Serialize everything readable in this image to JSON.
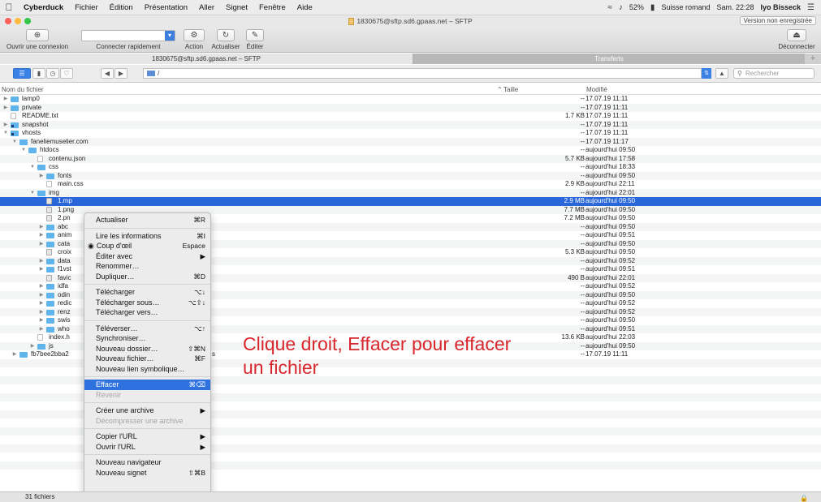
{
  "menubar": {
    "app": "Cyberduck",
    "items": [
      "Fichier",
      "Édition",
      "Présentation",
      "Aller",
      "Signet",
      "Fenêtre",
      "Aide"
    ],
    "battery": "52%",
    "input_source": "Suisse romand",
    "clock": "Sam. 22:28",
    "user": "Iyo Bisseck"
  },
  "window": {
    "title": "1830675@sftp.sd6.gpaas.net – SFTP",
    "unsaved_badge": "Version non enregistrée"
  },
  "toolbar": {
    "open_connection": "Ouvrir une connexion",
    "quick_connect": "Connecter rapidement",
    "action": "Action",
    "refresh": "Actualiser",
    "edit": "Éditer",
    "disconnect": "Déconnecter"
  },
  "tabs": {
    "active": "1830675@sftp.sd6.gpaas.net – SFTP",
    "inactive": "Transferts",
    "plus": "+"
  },
  "navbar": {
    "path": "/",
    "search_placeholder": "Rechercher"
  },
  "columns": {
    "name": "Nom du fichier",
    "size": "Taille",
    "modified": "Modifié"
  },
  "files": [
    {
      "name": "lamp0",
      "size": "--",
      "date": "17.07.19 11:11",
      "indent": 0,
      "kind": "folder",
      "toggle": "closed"
    },
    {
      "name": "private",
      "size": "--",
      "date": "17.07.19 11:11",
      "indent": 0,
      "kind": "folder",
      "toggle": "closed"
    },
    {
      "name": "README.txt",
      "size": "1.7 KB",
      "date": "17.07.19 11:11",
      "indent": 0,
      "kind": "file",
      "toggle": ""
    },
    {
      "name": "snapshot",
      "size": "--",
      "date": "17.07.19 11:11",
      "indent": 0,
      "kind": "sym",
      "toggle": "closed"
    },
    {
      "name": "vhosts",
      "size": "--",
      "date": "17.07.19 11:11",
      "indent": 0,
      "kind": "sym",
      "toggle": "open"
    },
    {
      "name": "faneliemuselier.com",
      "size": "--",
      "date": "17.07.19 11:17",
      "indent": 1,
      "kind": "folder",
      "toggle": "open"
    },
    {
      "name": "htdocs",
      "size": "--",
      "date": "aujourd'hui 09:50",
      "indent": 2,
      "kind": "folder",
      "toggle": "open"
    },
    {
      "name": "contenu.json",
      "size": "5.7 KB",
      "date": "aujourd'hui 17:58",
      "indent": 3,
      "kind": "file",
      "toggle": ""
    },
    {
      "name": "css",
      "size": "--",
      "date": "aujourd'hui 18:33",
      "indent": 3,
      "kind": "folder",
      "toggle": "open"
    },
    {
      "name": "fonts",
      "size": "--",
      "date": "aujourd'hui 09:50",
      "indent": 4,
      "kind": "folder",
      "toggle": "closed"
    },
    {
      "name": "main.css",
      "size": "2.9 KB",
      "date": "aujourd'hui 22:11",
      "indent": 4,
      "kind": "file",
      "toggle": ""
    },
    {
      "name": "img",
      "size": "--",
      "date": "aujourd'hui 22:01",
      "indent": 3,
      "kind": "folder",
      "toggle": "open"
    },
    {
      "name": "1.mp",
      "size": "2.9 MB",
      "date": "aujourd'hui 09:50",
      "indent": 4,
      "kind": "img",
      "toggle": "",
      "selected": true
    },
    {
      "name": "1.png",
      "size": "7.7 MB",
      "date": "aujourd'hui 09:50",
      "indent": 4,
      "kind": "img",
      "toggle": ""
    },
    {
      "name": "2.pn",
      "size": "7.2 MB",
      "date": "aujourd'hui 09:50",
      "indent": 4,
      "kind": "img",
      "toggle": ""
    },
    {
      "name": "abc",
      "size": "--",
      "date": "aujourd'hui 09:50",
      "indent": 4,
      "kind": "folder",
      "toggle": "closed"
    },
    {
      "name": "anim",
      "size": "--",
      "date": "aujourd'hui 09:51",
      "indent": 4,
      "kind": "folder",
      "toggle": "closed"
    },
    {
      "name": "cata",
      "size": "--",
      "date": "aujourd'hui 09:50",
      "indent": 4,
      "kind": "folder",
      "toggle": "closed"
    },
    {
      "name": "croix",
      "size": "5.3 KB",
      "date": "aujourd'hui 09:50",
      "indent": 4,
      "kind": "img",
      "toggle": ""
    },
    {
      "name": "data",
      "size": "--",
      "date": "aujourd'hui 09:52",
      "indent": 4,
      "kind": "folder",
      "toggle": "closed"
    },
    {
      "name": "f1vst",
      "size": "--",
      "date": "aujourd'hui 09:51",
      "indent": 4,
      "kind": "folder",
      "toggle": "closed"
    },
    {
      "name": "favic",
      "size": "490 B",
      "date": "aujourd'hui 22:01",
      "indent": 4,
      "kind": "img",
      "toggle": ""
    },
    {
      "name": "idfa",
      "size": "--",
      "date": "aujourd'hui 09:52",
      "indent": 4,
      "kind": "folder",
      "toggle": "closed"
    },
    {
      "name": "odin",
      "size": "--",
      "date": "aujourd'hui 09:50",
      "indent": 4,
      "kind": "folder",
      "toggle": "closed"
    },
    {
      "name": "redic",
      "size": "--",
      "date": "aujourd'hui 09:52",
      "indent": 4,
      "kind": "folder",
      "toggle": "closed"
    },
    {
      "name": "renz",
      "size": "--",
      "date": "aujourd'hui 09:52",
      "indent": 4,
      "kind": "folder",
      "toggle": "closed"
    },
    {
      "name": "swis",
      "size": "--",
      "date": "aujourd'hui 09:50",
      "indent": 4,
      "kind": "folder",
      "toggle": "closed"
    },
    {
      "name": "who",
      "size": "--",
      "date": "aujourd'hui 09:51",
      "indent": 4,
      "kind": "folder",
      "toggle": "closed"
    },
    {
      "name": "index.h",
      "size": "13.6 KB",
      "date": "aujourd'hui 22:03",
      "indent": 3,
      "kind": "file",
      "toggle": ""
    },
    {
      "name": "js",
      "size": "--",
      "date": "aujourd'hui 09:50",
      "indent": 3,
      "kind": "folder",
      "toggle": "closed"
    },
    {
      "name": "fb7bee2bba2",
      "size": "--",
      "date": "17.07.19 11:11",
      "indent": 1,
      "kind": "folder",
      "toggle": "closed",
      "suffix": "s"
    }
  ],
  "context_menu": {
    "groups": [
      [
        {
          "label": "Actualiser",
          "shortcut": "⌘R"
        }
      ],
      [
        {
          "label": "Lire les informations",
          "shortcut": "⌘I"
        },
        {
          "label": "Coup d'œil",
          "shortcut": "Espace",
          "icon": "eye-icon"
        },
        {
          "label": "Éditer avec",
          "shortcut": "▶"
        },
        {
          "label": "Renommer…",
          "shortcut": ""
        },
        {
          "label": "Dupliquer…",
          "shortcut": "⌘D"
        }
      ],
      [
        {
          "label": "Télécharger",
          "shortcut": "⌥↓"
        },
        {
          "label": "Télécharger sous…",
          "shortcut": "⌥⇧↓"
        },
        {
          "label": "Télécharger vers…",
          "shortcut": ""
        }
      ],
      [
        {
          "label": "Téléverser…",
          "shortcut": "⌥↑"
        },
        {
          "label": "Synchroniser…",
          "shortcut": ""
        },
        {
          "label": "Nouveau dossier…",
          "shortcut": "⇧⌘N"
        },
        {
          "label": "Nouveau fichier…",
          "shortcut": "⌘F"
        },
        {
          "label": "Nouveau lien symbolique…",
          "shortcut": ""
        }
      ],
      [
        {
          "label": "Effacer",
          "shortcut": "⌘⌫",
          "highlighted": true
        },
        {
          "label": "Revenir",
          "shortcut": "",
          "disabled": true
        }
      ],
      [
        {
          "label": "Créer une archive",
          "shortcut": "▶"
        },
        {
          "label": "Décompresser une archive",
          "shortcut": "",
          "disabled": true
        }
      ],
      [
        {
          "label": "Copier l'URL",
          "shortcut": "▶"
        },
        {
          "label": "Ouvrir l'URL",
          "shortcut": "▶"
        }
      ],
      [
        {
          "label": "Nouveau navigateur",
          "shortcut": ""
        },
        {
          "label": "Nouveau signet",
          "shortcut": "⇧⌘B"
        }
      ]
    ]
  },
  "annotation": {
    "line1": "Clique droit, Effacer pour effacer",
    "line2": "un fichier"
  },
  "statusbar": {
    "count": "31 fichiers"
  },
  "colors": {
    "selection": "#2866d9",
    "menu_highlight": "#2e72e0",
    "annotation": "#d8262d",
    "folder": "#5fb4ec"
  }
}
